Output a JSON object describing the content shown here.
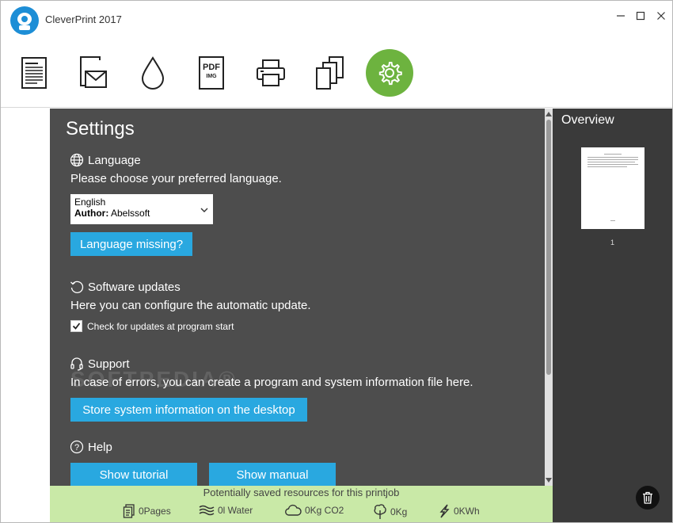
{
  "app": {
    "title": "CleverPrint 2017"
  },
  "settings": {
    "title": "Settings",
    "language": {
      "heading": "Language",
      "description": "Please choose your preferred language.",
      "selected_language": "English",
      "author_label": "Author:",
      "author_value": "Abelssoft",
      "missing_button": "Language missing?"
    },
    "updates": {
      "heading": "Software updates",
      "description": "Here you can configure the automatic update.",
      "checkbox_label": "Check for updates at program start",
      "checkbox_checked": true
    },
    "support": {
      "heading": "Support",
      "description": "In case of errors, you can create a program and system information file here.",
      "store_button": "Store system information on the desktop"
    },
    "help": {
      "heading": "Help",
      "tutorial_button": "Show tutorial",
      "manual_button": "Show manual"
    }
  },
  "watermark": "SOFTPEDIA®",
  "overview": {
    "title": "Overview",
    "page_number": "1"
  },
  "footer": {
    "caption": "Potentially saved resources for this printjob",
    "pages": "0Pages",
    "water": "0l Water",
    "co2": "0Kg CO2",
    "wood": "0Kg",
    "energy": "0KWh"
  },
  "colors": {
    "accent_green": "#6db33f",
    "button_blue": "#29a8e0",
    "panel_dark": "#4d4d4d",
    "footer_green": "#c9e9a7"
  }
}
